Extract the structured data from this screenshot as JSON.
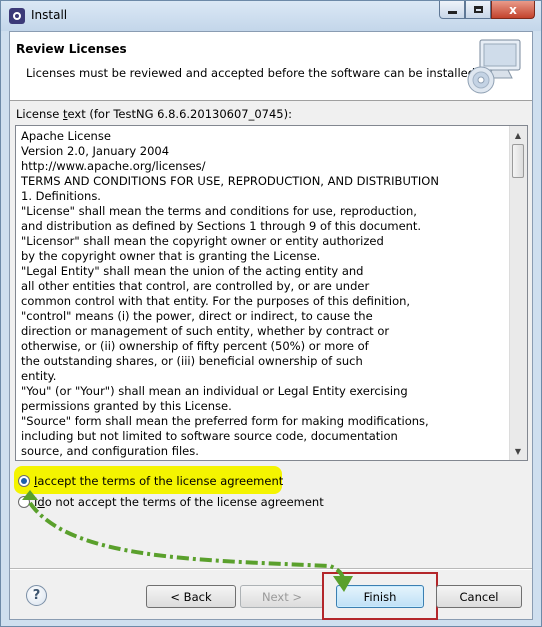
{
  "window": {
    "title": "Install",
    "close_symbol": "x"
  },
  "header": {
    "title": "Review Licenses",
    "description": "Licenses must be reviewed and accepted before the software can be installed."
  },
  "license": {
    "label_prefix": "License ",
    "label_underlined": "t",
    "label_rest": "ext (for TestNG 6.8.6.20130607_0745):",
    "lines": [
      "Apache License",
      "Version 2.0, January 2004",
      "http://www.apache.org/licenses/",
      "TERMS AND CONDITIONS FOR USE, REPRODUCTION, AND DISTRIBUTION",
      "1. Definitions.",
      "\"License\" shall mean the terms and conditions for use, reproduction,",
      "and distribution as defined by Sections 1 through 9 of this document.",
      "\"Licensor\" shall mean the copyright owner or entity authorized",
      "by the copyright owner that is granting the License.",
      "\"Legal Entity\" shall mean the union of the acting entity and",
      "all other entities that control, are controlled by, or are under",
      "common control with that entity. For the purposes of this definition,",
      "\"control\" means (i) the power, direct or indirect, to cause the",
      "direction or management of such entity, whether by contract or",
      "otherwise, or (ii) ownership of fifty percent (50%) or more of",
      "the outstanding shares, or (iii) beneficial ownership of such",
      "entity.",
      "\"You\" (or \"Your\") shall mean an individual or Legal Entity exercising",
      "permissions granted by this License.",
      "\"Source\" form shall mean the preferred form for making modifications,",
      "including but not limited to software source code, documentation",
      "source, and configuration files."
    ]
  },
  "options": {
    "accept_underlined": "I",
    "accept_rest": " accept the terms of the license agreement",
    "decline_prefix": "I ",
    "decline_underlined": "d",
    "decline_rest": "o not accept the terms of the license agreement",
    "selected": "accept"
  },
  "buttons": {
    "help": "?",
    "back": "< Back",
    "back_underlined": "B",
    "next": "Next >",
    "next_underlined": "N",
    "finish": "Finish",
    "finish_underlined": "F",
    "cancel": "Cancel"
  },
  "colors": {
    "highlight": "#f4f400",
    "annotation_arrow": "#5aa02c",
    "annotation_box": "#b3262a"
  }
}
